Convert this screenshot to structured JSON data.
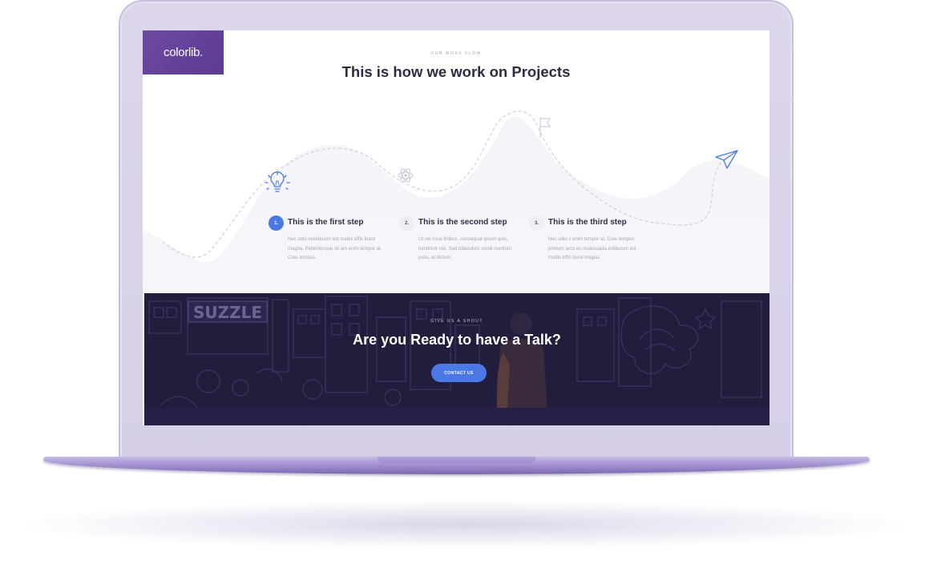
{
  "logo": {
    "text": "colorlib."
  },
  "workflow": {
    "eyebrow": "OUR WORK FLOW",
    "title": "This is how we work on Projects",
    "steps": [
      {
        "number": "1.",
        "title": "This is the first step",
        "body": "Nec odio vestibulum est mattis effic iturut magna. Pellentesque sit am enim tempor at. Cras tempus.",
        "active": true
      },
      {
        "number": "2.",
        "title": "This is the second step",
        "body": "Ut vel risus finibus, consequat ipsum quis, hendrerit nisi. Sed bibendum condi-mentum justo, at dictum.",
        "active": false
      },
      {
        "number": "3.",
        "title": "This is the third step",
        "body": "Nec odio v enim tempor at. Cras tempus pretium arcu eu malesuada.estibulum est mattis effic iturut magna.",
        "active": false
      }
    ],
    "icons": [
      "lightbulb-icon",
      "atom-icon",
      "flag-icon",
      "paper-plane-icon"
    ]
  },
  "cta": {
    "eyebrow": "GIVE US A SHOUT",
    "title": "Are you Ready to have a Talk?",
    "button_label": "CONTACT US",
    "sign_text": "SUZZLE"
  },
  "colors": {
    "accent": "#4a79e6",
    "logo_bg": "#6d4aa2",
    "heading": "#2c2d42",
    "cta_bg": "#231d3d",
    "laptop": "#d6cfe6"
  }
}
